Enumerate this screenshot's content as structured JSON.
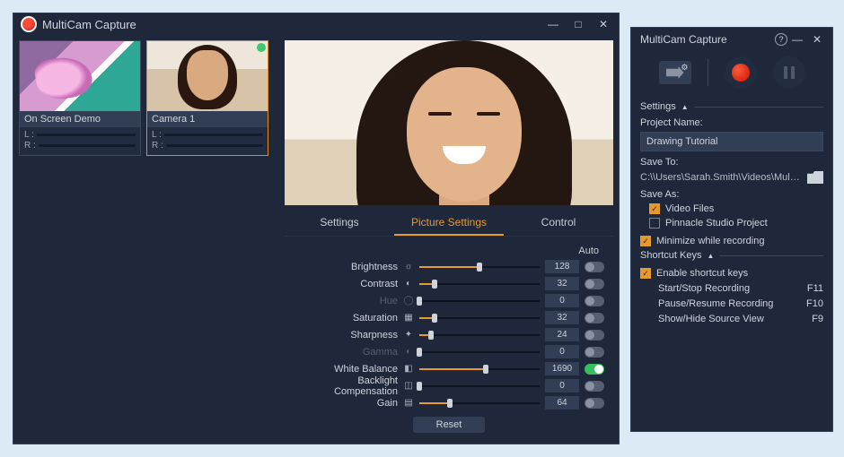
{
  "main": {
    "title": "MultiCam Capture",
    "sources": [
      {
        "label": "On Screen Demo",
        "status": "inactive"
      },
      {
        "label": "Camera 1",
        "status": "active",
        "selected": true
      }
    ],
    "audio_channels": {
      "left": "L :",
      "right": "R :"
    },
    "tabs": [
      "Settings",
      "Picture Settings",
      "Control"
    ],
    "active_tab": 1,
    "auto_label": "Auto",
    "reset_label": "Reset",
    "sliders": [
      {
        "name": "Brightness",
        "icon": "☼",
        "value": 128,
        "pct": 50,
        "auto": false,
        "disabled": false
      },
      {
        "name": "Contrast",
        "icon": "◐",
        "value": 32,
        "pct": 13,
        "auto": false,
        "disabled": false
      },
      {
        "name": "Hue",
        "icon": "◯",
        "value": 0,
        "pct": 0,
        "auto": false,
        "disabled": true
      },
      {
        "name": "Saturation",
        "icon": "▦",
        "value": 32,
        "pct": 13,
        "auto": false,
        "disabled": false
      },
      {
        "name": "Sharpness",
        "icon": "✦",
        "value": 24,
        "pct": 10,
        "auto": false,
        "disabled": false
      },
      {
        "name": "Gamma",
        "icon": "◐",
        "value": 0,
        "pct": 0,
        "auto": false,
        "disabled": true
      },
      {
        "name": "White Balance",
        "icon": "◧",
        "value": 1690,
        "pct": 55,
        "auto": true,
        "disabled": false
      },
      {
        "name": "Backlight Compensation",
        "icon": "◫",
        "value": 0,
        "pct": 0,
        "auto": false,
        "disabled": false
      },
      {
        "name": "Gain",
        "icon": "▤",
        "value": 64,
        "pct": 25,
        "auto": false,
        "disabled": false
      }
    ]
  },
  "side": {
    "title": "MultiCam Capture",
    "sections": {
      "settings": "Settings",
      "shortcuts": "Shortcut Keys"
    },
    "project_name_label": "Project Name:",
    "project_name_value": "Drawing Tutorial",
    "save_to_label": "Save To:",
    "save_to_value": "C:\\\\Users\\Sarah.Smith\\Videos\\MultiCam...",
    "save_as_label": "Save As:",
    "save_as_options": [
      {
        "label": "Video Files",
        "checked": true
      },
      {
        "label": "Pinnacle Studio Project",
        "checked": false
      }
    ],
    "minimize_label": "Minimize while recording",
    "minimize_checked": true,
    "enable_shortcuts_label": "Enable shortcut keys",
    "enable_shortcuts_checked": true,
    "shortcuts": [
      {
        "label": "Start/Stop Recording",
        "key": "F11"
      },
      {
        "label": "Pause/Resume Recording",
        "key": "F10"
      },
      {
        "label": "Show/Hide Source View",
        "key": "F9"
      }
    ]
  }
}
